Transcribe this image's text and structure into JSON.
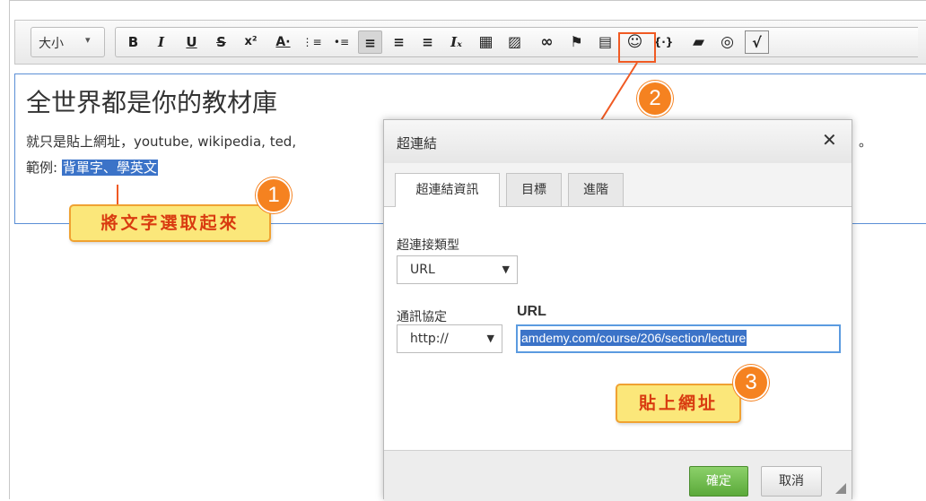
{
  "toolbar": {
    "size_label": "大小",
    "size_caret": "▾",
    "buttons": [
      {
        "name": "bold-button",
        "glyph": "B"
      },
      {
        "name": "italic-button",
        "glyph": "I"
      },
      {
        "name": "underline-button",
        "glyph": "U"
      },
      {
        "name": "strikethrough-button",
        "glyph": "S"
      },
      {
        "name": "superscript-button",
        "glyph": "x²"
      },
      {
        "name": "font-color-button",
        "glyph": "A·"
      },
      {
        "name": "numbered-list-button",
        "glyph": "⋮≡"
      },
      {
        "name": "bulleted-list-button",
        "glyph": "•≡"
      },
      {
        "name": "align-left-button",
        "glyph": "≡"
      },
      {
        "name": "align-center-button",
        "glyph": "≡"
      },
      {
        "name": "align-right-button",
        "glyph": "≡"
      },
      {
        "name": "remove-format-button",
        "glyph": "Iₓ"
      },
      {
        "name": "table-button",
        "glyph": "▦"
      },
      {
        "name": "image-button",
        "glyph": "▨"
      },
      {
        "name": "link-button",
        "glyph": "∞"
      },
      {
        "name": "anchor-button",
        "glyph": "⚑"
      },
      {
        "name": "templates-button",
        "glyph": "▤"
      },
      {
        "name": "smiley-button",
        "glyph": "☺"
      },
      {
        "name": "source-code-button",
        "glyph": "{·}"
      },
      {
        "name": "file-browser-button",
        "glyph": "▰"
      },
      {
        "name": "language-button",
        "glyph": "◎"
      },
      {
        "name": "math-button",
        "glyph": "√"
      }
    ]
  },
  "editor": {
    "title": "全世界都是你的教材庫",
    "line1": "就只是貼上網址，youtube, wikipedia, ted,",
    "line1_tail": "。",
    "line2_prefix": "範例: ",
    "line2_selected": "背單字、學英文"
  },
  "callouts": {
    "step1_text": "將文字選取起來",
    "step1_badge": "1",
    "step2_badge": "2",
    "step3_text": "貼上網址",
    "step3_badge": "3"
  },
  "dialog": {
    "title": "超連結",
    "close": "✕",
    "tabs": [
      {
        "label": "超連結資訊"
      },
      {
        "label": "目標"
      },
      {
        "label": "進階"
      }
    ],
    "link_type_label": "超連接類型",
    "link_type_value": "URL",
    "protocol_label": "通訊協定",
    "protocol_value": "http://",
    "url_label": "URL",
    "url_value": "amdemy.com/course/206/section/lecture",
    "ok_label": "確定",
    "cancel_label": "取消",
    "select_arrow": "▼"
  },
  "colors": {
    "accent_orange": "#f05a23",
    "callout_fill": "#fbe77a",
    "selection_blue": "#3b73c8",
    "ok_green": "#5ba93a"
  }
}
